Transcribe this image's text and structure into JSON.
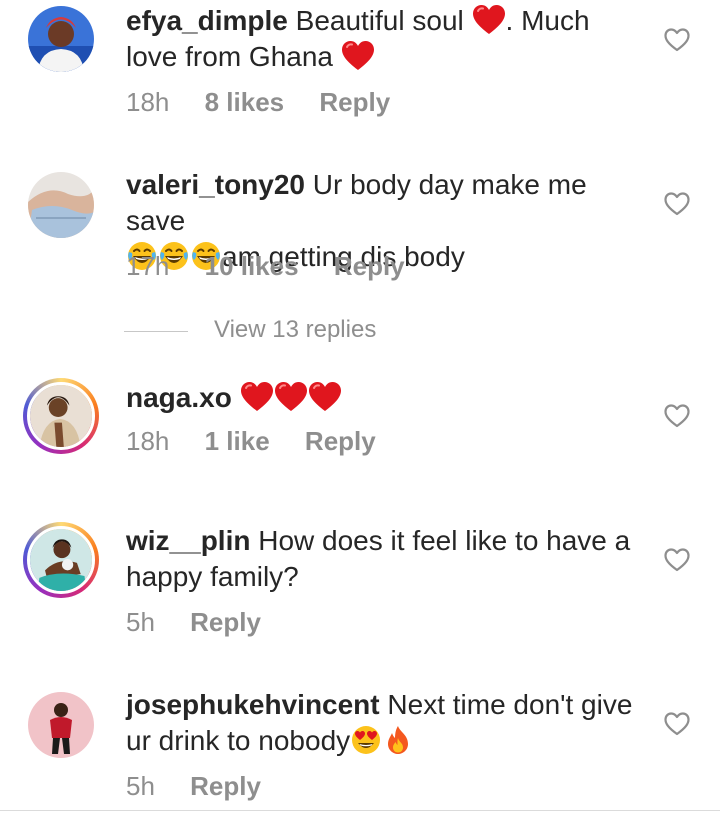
{
  "comments": [
    {
      "username": "efya_dimple",
      "text_part1": " Beautiful soul ",
      "text_part2": ". Much love from Ghana ",
      "time": "18h",
      "likes": "8 likes",
      "reply": "Reply",
      "avatar_ring": false
    },
    {
      "username": "valeri_tony20",
      "text_part1": " Ur body day make me save ",
      "text_part2": "am getting dis body",
      "time": "17h",
      "likes": "10 likes",
      "reply": "Reply",
      "avatar_ring": false
    },
    {
      "username": "naga.xo",
      "text_part1": " ",
      "time": "18h",
      "likes": "1 like",
      "reply": "Reply",
      "avatar_ring": true
    },
    {
      "username": "wiz__plin",
      "text_part1": " How does it feel like to have a happy family?",
      "time": "5h",
      "reply": "Reply",
      "avatar_ring": true
    },
    {
      "username": "josephukehvincent",
      "text_part1": " Next time don't give ur drink to nobody",
      "time": "5h",
      "reply": "Reply",
      "avatar_ring": false
    }
  ],
  "view_replies": "View 13 replies",
  "icons": {
    "like": "heart-outline-icon",
    "emoji_heart": "red-heart-emoji",
    "emoji_laugh": "tears-of-joy-emoji",
    "emoji_heart_eyes": "heart-eyes-emoji",
    "emoji_fire": "fire-emoji"
  },
  "colors": {
    "text": "#262626",
    "meta": "#8e8e8e",
    "heart": "#e0161e"
  }
}
